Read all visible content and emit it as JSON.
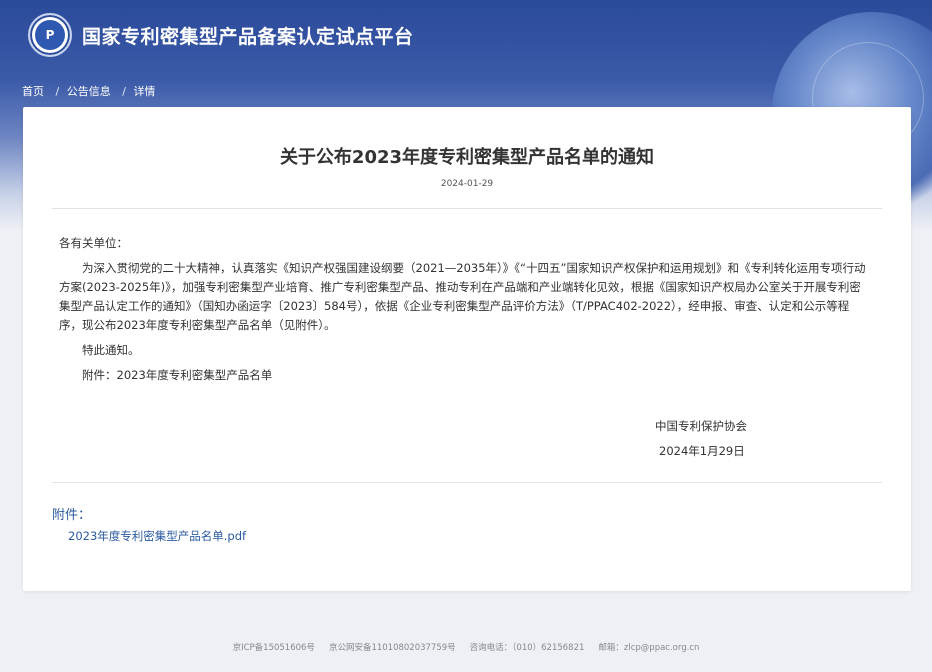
{
  "header": {
    "logo_text": "P",
    "site_title": "国家专利密集型产品备案认定试点平台"
  },
  "breadcrumb": {
    "items": [
      "首页",
      "公告信息",
      "详情"
    ],
    "separator": "/"
  },
  "article": {
    "title": "关于公布2023年度专利密集型产品名单的通知",
    "date": "2024-01-29",
    "salutation": "各有关单位：",
    "paragraph": "为深入贯彻党的二十大精神，认真落实《知识产权强国建设纲要（2021—2035年）》《“十四五”国家知识产权保护和运用规划》和《专利转化运用专项行动方案(2023-2025年)》，加强专利密集型产业培育、推广专利密集型产品、推动专利在产品端和产业端转化见效，根据《国家知识产权局办公室关于开展专利密集型产品认定工作的通知》（国知办函运字〔2023〕584号），依据《企业专利密集型产品评价方法》（T/PPAC402-2022），经申报、审查、认定和公示等程序，现公布2023年度专利密集型产品名单（见附件）。",
    "notice": "特此通知。",
    "attachment_line": "附件：2023年度专利密集型产品名单",
    "signer": "中国专利保护协会",
    "sign_date": "2024年1月29日"
  },
  "attachments": {
    "label": "附件：",
    "file_name": "2023年度专利密集型产品名单.pdf"
  },
  "footer": {
    "icp": "京ICP备15051606号",
    "police": "京公网安备11010802037759号",
    "phone": "咨询电话：（010）62156821",
    "email": "邮箱：zlcp@ppac.org.cn"
  },
  "colors": {
    "header_blue": "#2a4a9a",
    "link_blue": "#2c5aa0"
  }
}
